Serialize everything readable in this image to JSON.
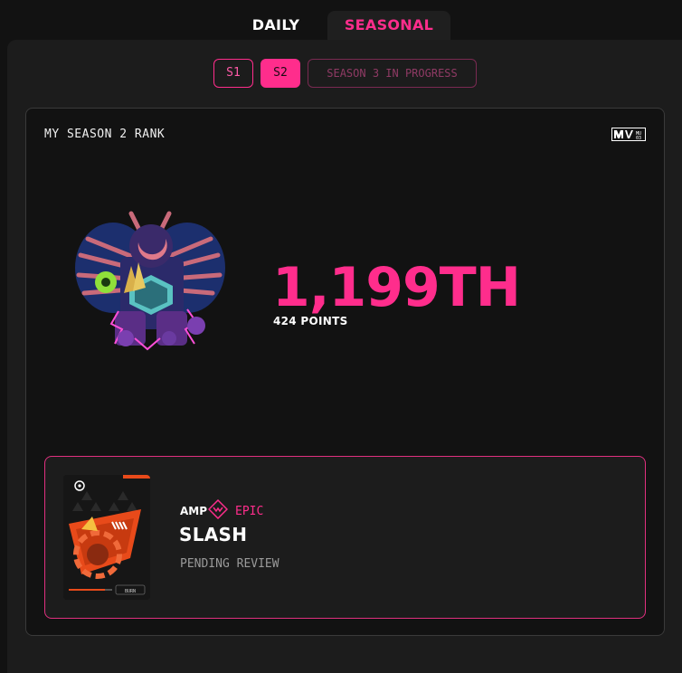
{
  "tabs": {
    "daily": "DAILY",
    "seasonal": "SEASONAL"
  },
  "seasons": {
    "s1": "S1",
    "s2": "S2",
    "s3": "SEASON 3 IN PROGRESS"
  },
  "rank_card": {
    "title": "MY SEASON 2 RANK",
    "logo_text": "MU 03",
    "rank": "1,199TH",
    "points": "424 POINTS"
  },
  "item": {
    "type": "AMP",
    "rarity": "EPIC",
    "name": "SLASH",
    "status": "PENDING REVIEW",
    "card_button": "BURN"
  },
  "colors": {
    "accent": "#ff2d8c",
    "background": "#121212",
    "panel": "#1c1c1c"
  },
  "icons": {
    "logo": "mu-logo-icon",
    "rarity": "epic-rarity-icon",
    "avatar": "mech-avatar-image",
    "item_art": "slash-amp-card-image"
  }
}
